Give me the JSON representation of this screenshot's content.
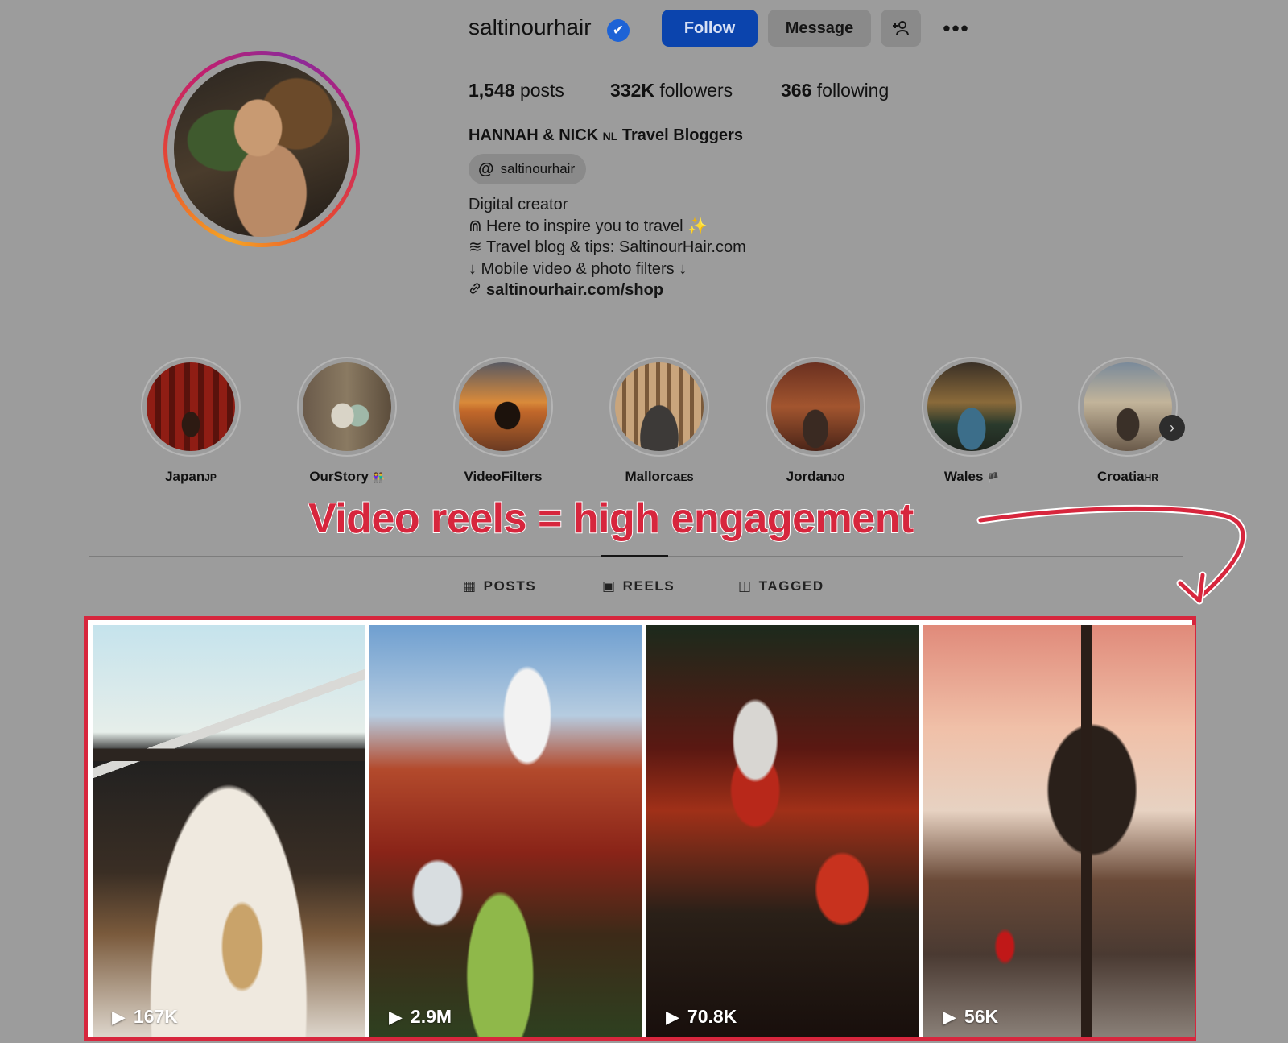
{
  "profile": {
    "username": "saltinourhair",
    "verified_icon": "✔",
    "buttons": {
      "follow": "Follow",
      "message": "Message",
      "add_user_icon": "+ᴗ",
      "more_icon": "•••"
    },
    "stats": {
      "posts_count": "1,548",
      "posts_label": "posts",
      "followers_count": "332K",
      "followers_label": "followers",
      "following_count": "366",
      "following_label": "following"
    },
    "full_name": "HANNAH & NICK",
    "full_name_flag": "NL",
    "full_name_suffix": "Travel Bloggers",
    "threads_handle": "saltinourhair",
    "threads_icon": "@",
    "bio": {
      "category": "Digital creator",
      "line1_icon": "⋒",
      "line1": "Here to inspire you to travel",
      "line1_emoji": "✨",
      "line2_icon": "≋",
      "line2": "Travel blog & tips: SaltinourHair.com",
      "line3": "↓ Mobile video & photo filters ↓",
      "link_icon": "🔗",
      "link": "saltinourhair.com/shop"
    }
  },
  "highlights": [
    {
      "name": "Japan",
      "suffix": "JP"
    },
    {
      "name": "OurStory",
      "suffix": "👫"
    },
    {
      "name": "VideoFilters",
      "suffix": ""
    },
    {
      "name": "Mallorca",
      "suffix": "ES"
    },
    {
      "name": "Jordan",
      "suffix": "JO"
    },
    {
      "name": "Wales",
      "suffix": "🏴"
    },
    {
      "name": "Croatia",
      "suffix": "HR"
    }
  ],
  "highlights_next_icon": "›",
  "annotation": "Video reels = high engagement",
  "tabs": [
    {
      "icon": "▦",
      "label": "POSTS"
    },
    {
      "icon": "▣",
      "label": "REELS"
    },
    {
      "icon": "◫",
      "label": "TAGGED"
    }
  ],
  "active_tab": "REELS",
  "reels": [
    {
      "views": "167K",
      "play_icon": "▶"
    },
    {
      "views": "2.9M",
      "play_icon": "▶"
    },
    {
      "views": "70.8K",
      "play_icon": "▶"
    },
    {
      "views": "56K",
      "play_icon": "▶"
    }
  ],
  "colors": {
    "page_bg": "#9c9c9c",
    "follow_button": "#0b44ad",
    "verified": "#1d63d6",
    "annotation": "#d7263d"
  }
}
